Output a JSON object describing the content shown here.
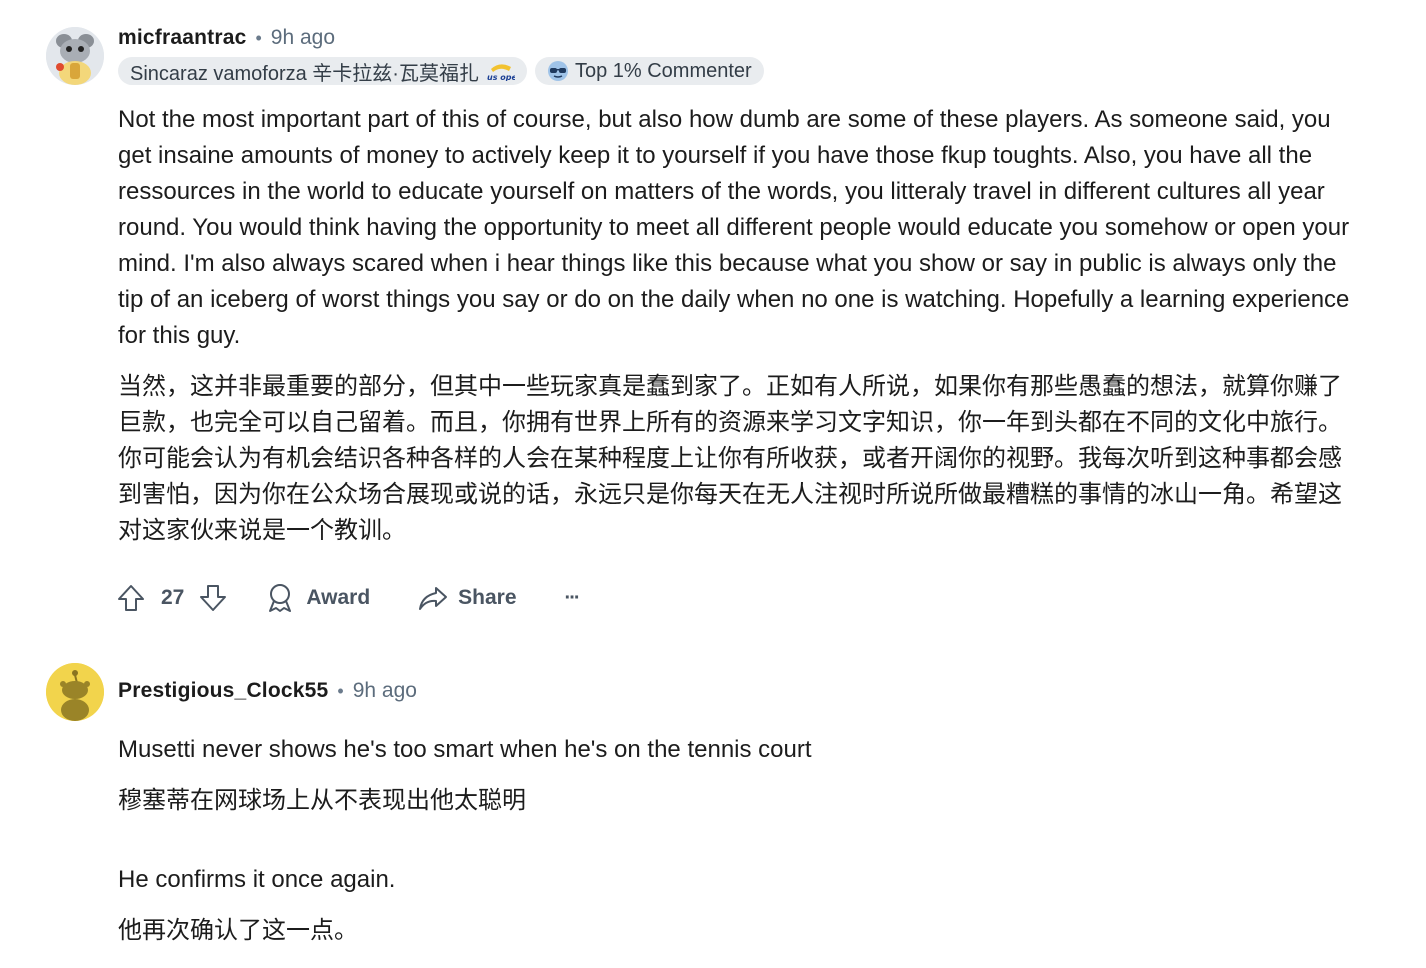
{
  "comments": [
    {
      "username": "micfraantrac",
      "time": "9h ago",
      "flair_text": "Sincaraz vamoforza 辛卡拉兹·瓦莫福扎",
      "flair_image": "us-open-logo",
      "badge_text": "Top 1% Commenter",
      "badge_icon": "sunglasses-icon",
      "paragraphs": [
        "Not the most important part of this of course, but also how dumb are some of these players. As someone said, you get insaine amounts of money to actively keep it to yourself if you have those fkup toughts. Also, you have all the ressources in the world to educate yourself on matters of the words, you litteraly travel in different cultures all year round. You would think having the opportunity to meet all different people would educate you somehow or open your mind. I'm also always scared when i hear things like this because what you show or say in public is always only the tip of an iceberg of worst things you say or do on the daily when no one is watching. Hopefully a learning experience for this guy.",
        "当然，这并非最重要的部分，但其中一些玩家真是蠢到家了。正如有人所说，如果你有那些愚蠢的想法，就算你赚了巨款，也完全可以自己留着。而且，你拥有世界上所有的资源来学习文字知识，你一年到头都在不同的文化中旅行。你可能会认为有机会结识各种各样的人会在某种程度上让你有所收获，或者开阔你的视野。我每次听到这种事都会感到害怕，因为你在公众场合展现或说的话，永远只是你每天在无人注视时所说所做最糟糕的事情的冰山一角。希望这对这家伙来说是一个教训。"
      ],
      "score": "27",
      "award_label": "Award",
      "share_label": "Share",
      "more_label": "···"
    },
    {
      "username": "Prestigious_Clock55",
      "time": "9h ago",
      "paragraphs": [
        "Musetti never shows he's too smart when he's on the tennis court",
        "穆塞蒂在网球场上从不表现出他太聪明",
        "He confirms it once again.",
        "他再次确认了这一点。"
      ]
    }
  ],
  "colors": {
    "flair_bg": "#e9ecef",
    "meta_gray": "#5c6c7c",
    "avatar_yellow": "#f2d44c"
  }
}
